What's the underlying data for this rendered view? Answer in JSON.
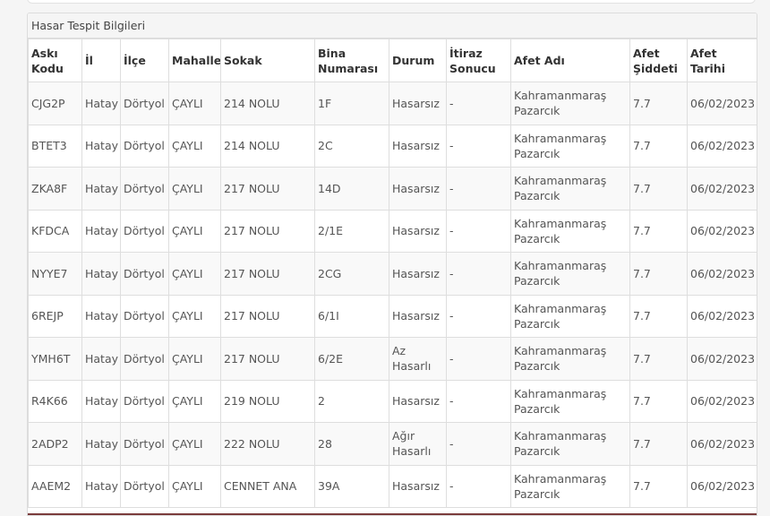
{
  "panel": {
    "title": "Hasar Tespit Bilgileri"
  },
  "columns": [
    "Askı Kodu",
    "İl",
    "İlçe",
    "Mahalle",
    "Sokak",
    "Bina Numarası",
    "Durum",
    "İtiraz Sonucu",
    "Afet Adı",
    "Afet Şiddeti",
    "Afet Tarihi"
  ],
  "rows": [
    {
      "aski": "CJG2P",
      "il": "Hatay",
      "ilce": "Dörtyol",
      "mahalle": "ÇAYLI",
      "sokak": "214 NOLU",
      "bina": "1F",
      "durum": "Hasarsız",
      "itiraz": "-",
      "afet": "Kahramanmaraş Pazarcık",
      "siddet": "7.7",
      "tarih": "06/02/2023"
    },
    {
      "aski": "BTET3",
      "il": "Hatay",
      "ilce": "Dörtyol",
      "mahalle": "ÇAYLI",
      "sokak": "214 NOLU",
      "bina": "2C",
      "durum": "Hasarsız",
      "itiraz": "-",
      "afet": "Kahramanmaraş Pazarcık",
      "siddet": "7.7",
      "tarih": "06/02/2023"
    },
    {
      "aski": "ZKA8F",
      "il": "Hatay",
      "ilce": "Dörtyol",
      "mahalle": "ÇAYLI",
      "sokak": "217 NOLU",
      "bina": "14D",
      "durum": "Hasarsız",
      "itiraz": "-",
      "afet": "Kahramanmaraş Pazarcık",
      "siddet": "7.7",
      "tarih": "06/02/2023"
    },
    {
      "aski": "KFDCA",
      "il": "Hatay",
      "ilce": "Dörtyol",
      "mahalle": "ÇAYLI",
      "sokak": "217 NOLU",
      "bina": "2/1E",
      "durum": "Hasarsız",
      "itiraz": "-",
      "afet": "Kahramanmaraş Pazarcık",
      "siddet": "7.7",
      "tarih": "06/02/2023"
    },
    {
      "aski": "NYYE7",
      "il": "Hatay",
      "ilce": "Dörtyol",
      "mahalle": "ÇAYLI",
      "sokak": "217 NOLU",
      "bina": "2CG",
      "durum": "Hasarsız",
      "itiraz": "-",
      "afet": "Kahramanmaraş Pazarcık",
      "siddet": "7.7",
      "tarih": "06/02/2023"
    },
    {
      "aski": "6REJP",
      "il": "Hatay",
      "ilce": "Dörtyol",
      "mahalle": "ÇAYLI",
      "sokak": "217 NOLU",
      "bina": "6/1I",
      "durum": "Hasarsız",
      "itiraz": "-",
      "afet": "Kahramanmaraş Pazarcık",
      "siddet": "7.7",
      "tarih": "06/02/2023"
    },
    {
      "aski": "YMH6T",
      "il": "Hatay",
      "ilce": "Dörtyol",
      "mahalle": "ÇAYLI",
      "sokak": "217 NOLU",
      "bina": "6/2E",
      "durum": "Az Hasarlı",
      "itiraz": "-",
      "afet": "Kahramanmaraş Pazarcık",
      "siddet": "7.7",
      "tarih": "06/02/2023"
    },
    {
      "aski": "R4K66",
      "il": "Hatay",
      "ilce": "Dörtyol",
      "mahalle": "ÇAYLI",
      "sokak": "219 NOLU",
      "bina": "2",
      "durum": "Hasarsız",
      "itiraz": "-",
      "afet": "Kahramanmaraş Pazarcık",
      "siddet": "7.7",
      "tarih": "06/02/2023"
    },
    {
      "aski": "2ADP2",
      "il": "Hatay",
      "ilce": "Dörtyol",
      "mahalle": "ÇAYLI",
      "sokak": "222 NOLU",
      "bina": "28",
      "durum": "Ağır Hasarlı",
      "itiraz": "-",
      "afet": "Kahramanmaraş Pazarcık",
      "siddet": "7.7",
      "tarih": "06/02/2023"
    },
    {
      "aski": "AAEM2",
      "il": "Hatay",
      "ilce": "Dörtyol",
      "mahalle": "ÇAYLI",
      "sokak": "CENNET ANA",
      "bina": "39A",
      "durum": "Hasarsız",
      "itiraz": "-",
      "afet": "Kahramanmaraş Pazarcık",
      "siddet": "7.7",
      "tarih": "06/02/2023"
    }
  ]
}
